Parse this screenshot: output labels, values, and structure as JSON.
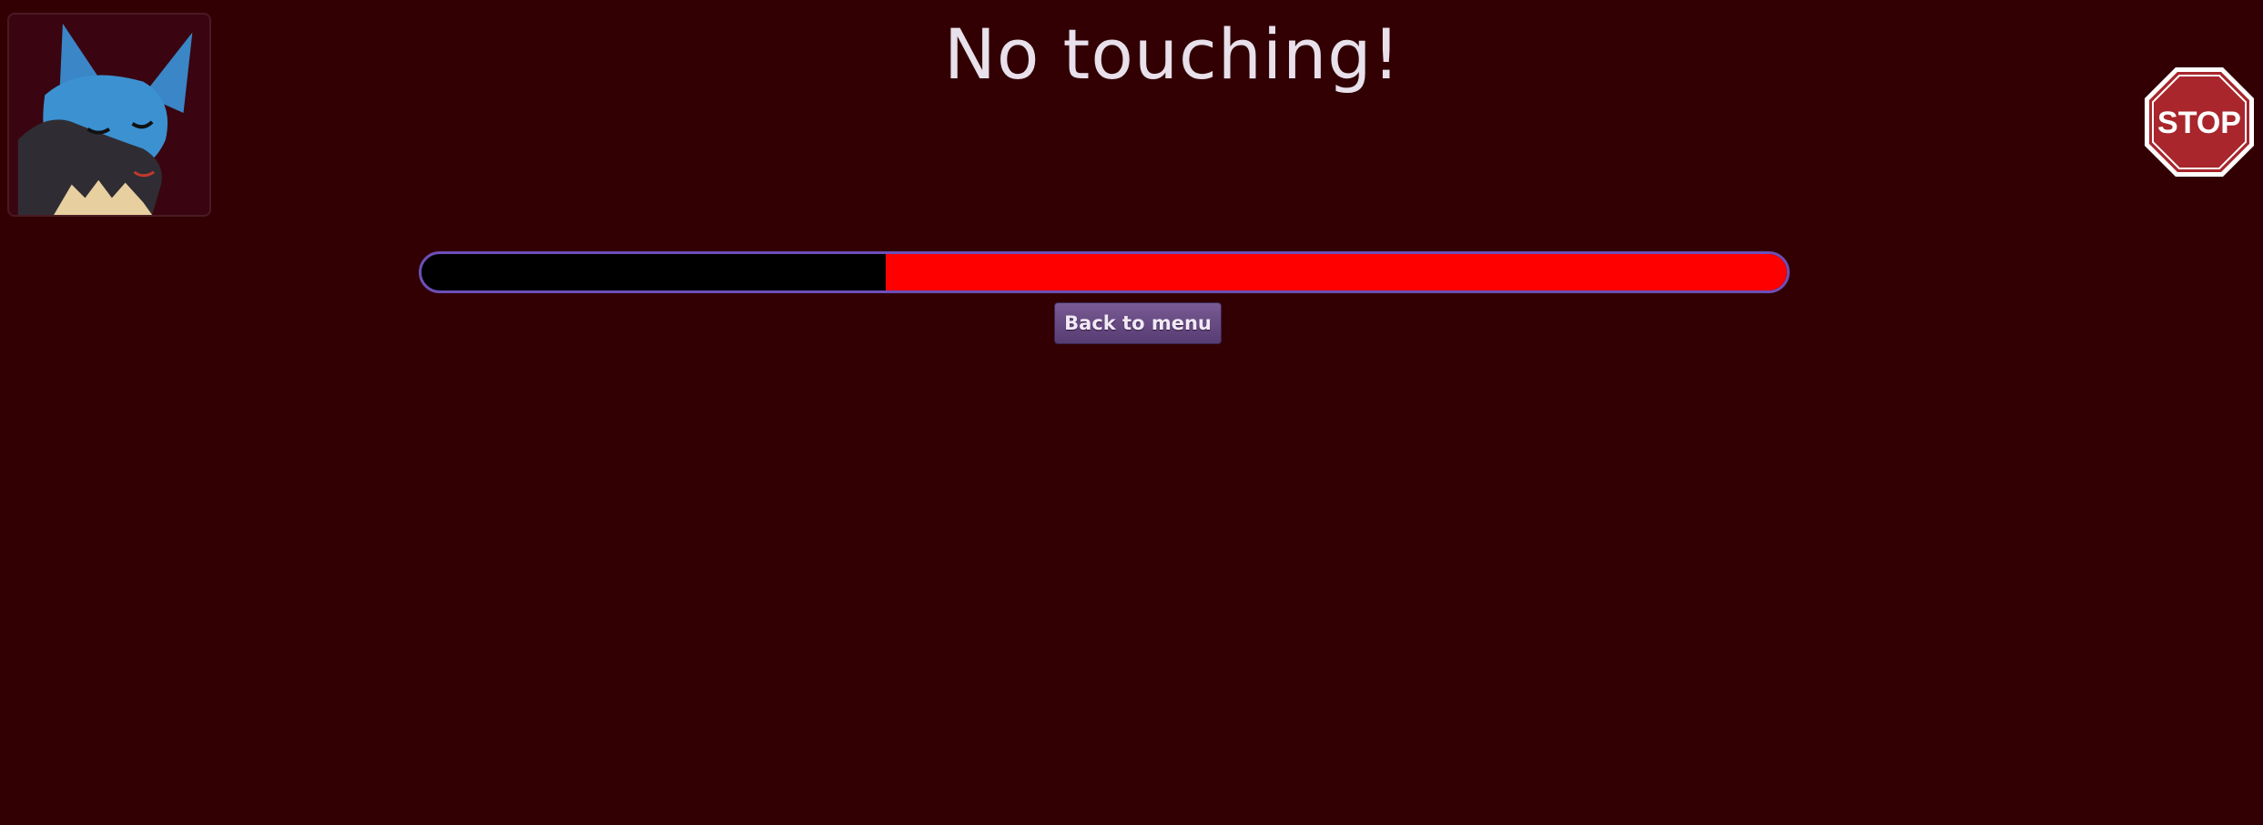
{
  "title": "No touching!",
  "stop_sign": {
    "text": "STOP",
    "icon": "stop-sign-icon",
    "color": "#a8262c"
  },
  "avatar": {
    "icon": "character-avatar"
  },
  "progress": {
    "filled_fraction": 0.66,
    "fill_color": "#ff0000",
    "track_color": "#000000",
    "border_color": "#6c4fb8"
  },
  "back_button": {
    "label": "Back to menu"
  },
  "colors": {
    "background": "#320003",
    "title": "#e8e0ea",
    "button": "#6a4c85"
  }
}
